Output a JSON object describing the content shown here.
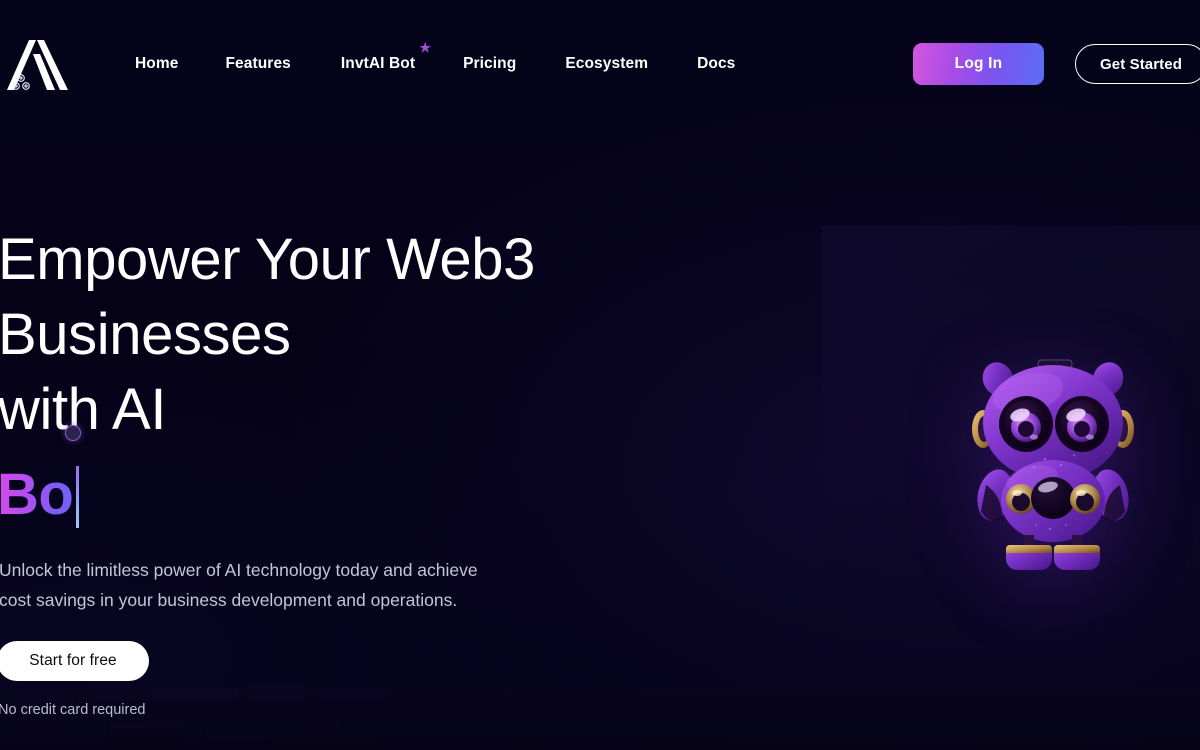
{
  "theme": {
    "background": "#04021a",
    "accent_pink": "#d457dd",
    "accent_purple": "#a84ce8",
    "accent_blue": "#5a6ef6",
    "text_primary": "#ffffff",
    "text_muted": "#c3c6d6",
    "cta_bg": "#ffffff",
    "cta_text": "#0a0a14"
  },
  "header": {
    "logo_name": "invtai-logo",
    "nav": [
      {
        "label": "Home",
        "badge": null
      },
      {
        "label": "Features",
        "badge": null
      },
      {
        "label": "InvtAI Bot",
        "badge": "★"
      },
      {
        "label": "Pricing",
        "badge": null
      },
      {
        "label": "Ecosystem",
        "badge": null
      },
      {
        "label": "Docs",
        "badge": null
      }
    ],
    "login_label": "Log In",
    "get_started_label": "Get Started"
  },
  "hero": {
    "title": "Empower Your Web3 Businesses\nwith AI",
    "typed_word": "Bo",
    "caret": "|",
    "subtitle": "Unlock the limitless power of AI technology today and achieve cost savings in your business development and operations.",
    "cta_label": "Start for free",
    "note": "No credit card required",
    "mascot_name": "invtai-robot-mascot"
  }
}
